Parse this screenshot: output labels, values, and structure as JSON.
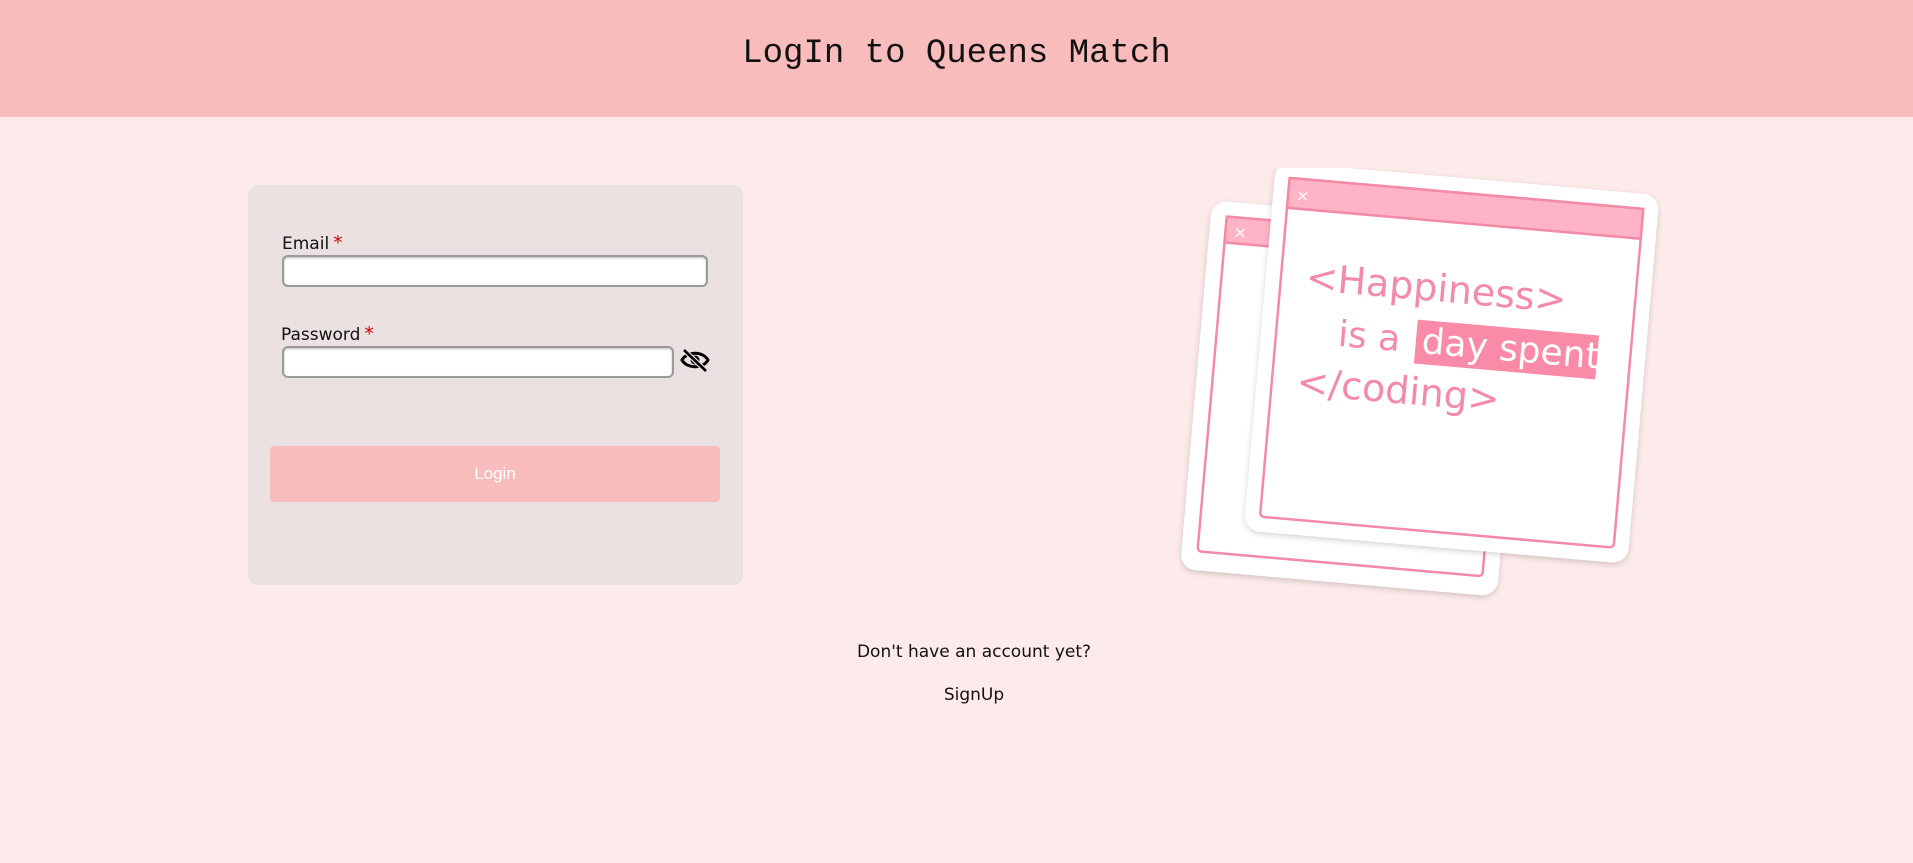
{
  "header": {
    "title": "LogIn to Queens Match"
  },
  "login_form": {
    "email_label": "Email",
    "email_required_mark": "*",
    "email_value": "",
    "password_label": "Password",
    "password_required_mark": "*",
    "password_value": "",
    "toggle_icon": "eye-slash-icon",
    "login_label": "Login"
  },
  "signup": {
    "prompt": "Don't have an account yet?",
    "link_label": "SignUp"
  },
  "illustration": {
    "line1": "<Happiness>",
    "line2_prefix": "is a",
    "line2_highlight": "day spent",
    "line3": "</coding>",
    "close_glyph": "×"
  },
  "colors": {
    "header_bg": "#f9bcbc",
    "page_bg": "#fdeaea",
    "card_bg": "#ebe1e1",
    "accent_pink": "#f28aa8",
    "required": "#d40000"
  }
}
